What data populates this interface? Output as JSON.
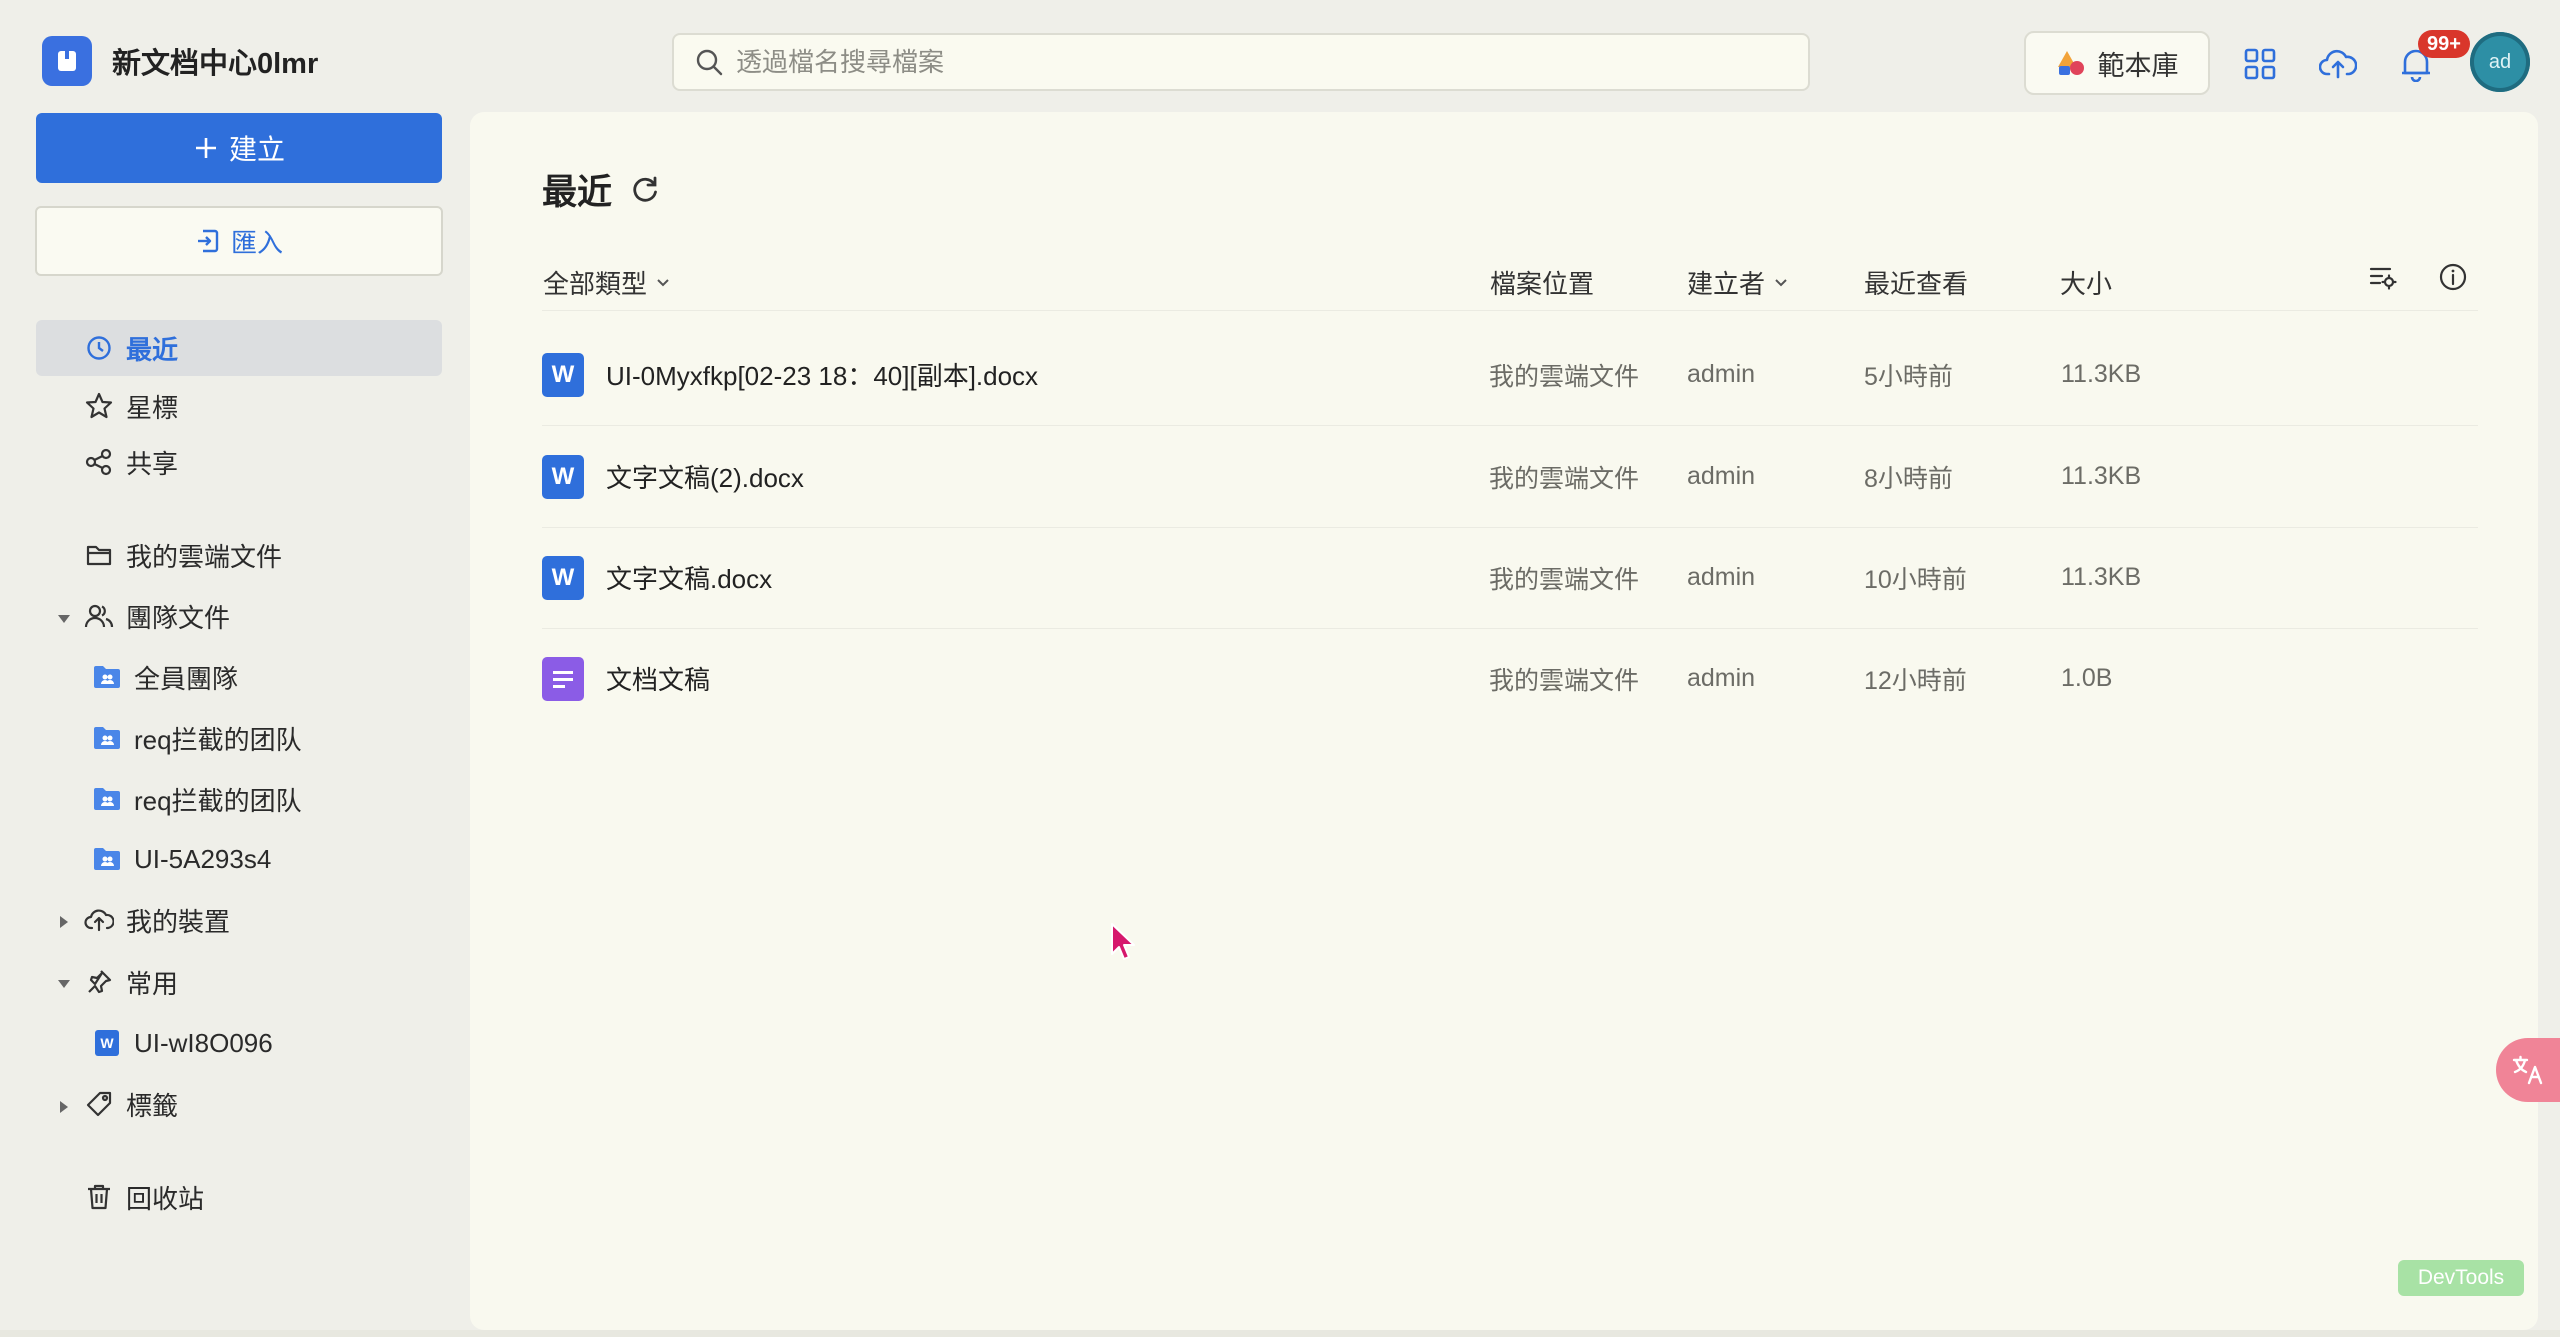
{
  "app": {
    "name": "新文档中心0lmr"
  },
  "search": {
    "placeholder": "透過檔名搜尋檔案"
  },
  "header": {
    "template_label": "範本庫",
    "notification_badge": "99+",
    "avatar_text": "ad"
  },
  "sidebar": {
    "create_label": "建立",
    "import_label": "匯入",
    "recent": "最近",
    "starred": "星標",
    "shared": "共享",
    "my_cloud": "我的雲端文件",
    "team_files": "團隊文件",
    "teams": [
      "全員團隊",
      "req拦截的团队",
      "req拦截的团队",
      "UI-5A293s4"
    ],
    "my_devices": "我的裝置",
    "frequent": "常用",
    "frequent_items": [
      "UI-wI8O096"
    ],
    "tags": "標籤",
    "trash": "回收站"
  },
  "main": {
    "title": "最近",
    "columns": {
      "type_filter": "全部類型",
      "location": "檔案位置",
      "creator": "建立者",
      "last_viewed": "最近查看",
      "size": "大小"
    },
    "rows": [
      {
        "icon": "word-file-icon",
        "name": "UI-0Myxfkp[02-23 18：40][副本].docx",
        "location": "我的雲端文件",
        "creator": "admin",
        "last_viewed": "5小時前",
        "size": "11.3KB"
      },
      {
        "icon": "word-file-icon",
        "name": "文字文稿(2).docx",
        "location": "我的雲端文件",
        "creator": "admin",
        "last_viewed": "8小時前",
        "size": "11.3KB"
      },
      {
        "icon": "word-file-icon",
        "name": "文字文稿.docx",
        "location": "我的雲端文件",
        "creator": "admin",
        "last_viewed": "10小時前",
        "size": "11.3KB"
      },
      {
        "icon": "doc-file-icon",
        "name": "文档文稿",
        "location": "我的雲端文件",
        "creator": "admin",
        "last_viewed": "12小時前",
        "size": "1.0B"
      }
    ]
  },
  "devtools_label": "DevTools",
  "colors": {
    "accent": "#2f6fdb",
    "badge": "#d9362b",
    "doc_purple": "#8b5ce6",
    "background": "#efefe9",
    "panel": "#f9f9ef"
  }
}
